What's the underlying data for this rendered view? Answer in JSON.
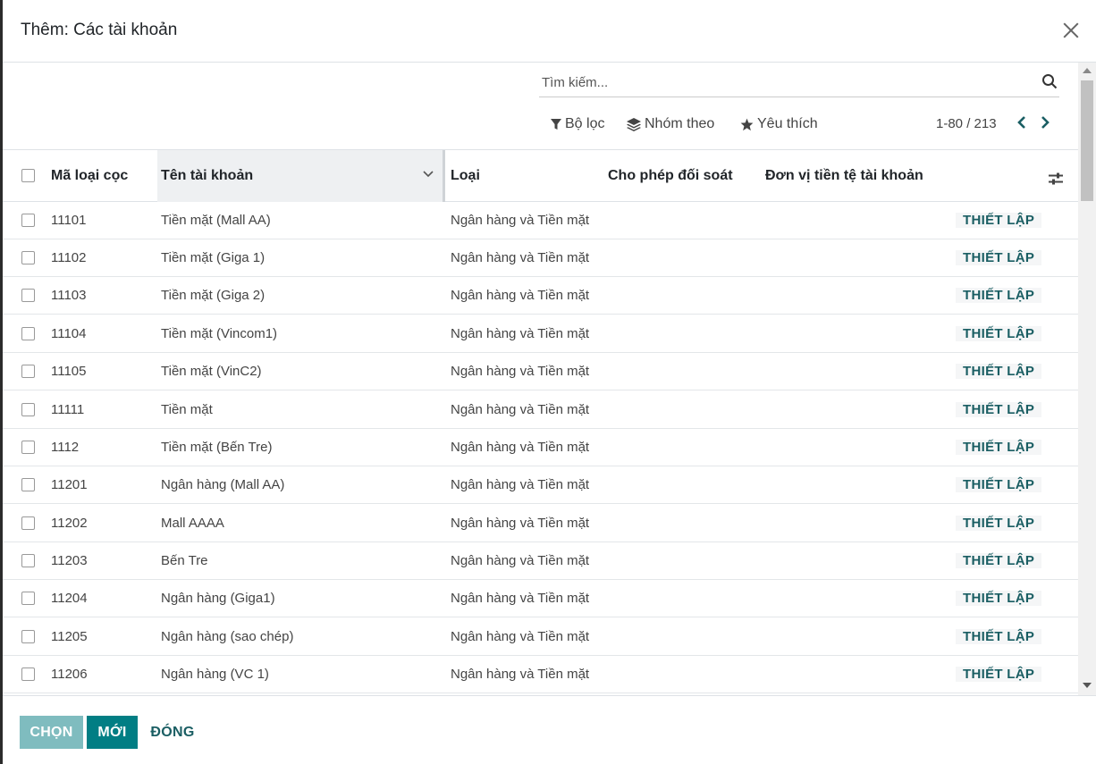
{
  "dialog": {
    "title": "Thêm: Các tài khoản"
  },
  "search": {
    "placeholder": "Tìm kiếm..."
  },
  "controls": {
    "filter_label": "Bộ lọc",
    "group_label": "Nhóm theo",
    "favorite_label": "Yêu thích",
    "pager": "1-80 / 213"
  },
  "table": {
    "headers": {
      "code": "Mã loại cọc",
      "name": "Tên tài khoản",
      "type": "Loại",
      "reconcile": "Cho phép đối soát",
      "currency": "Đơn vị tiền tệ tài khoản"
    },
    "rows": [
      {
        "code": "11101",
        "name": "Tiền mặt (Mall AA)",
        "type": "Ngân hàng và Tiền mặt",
        "action": "THIẾT LẬP"
      },
      {
        "code": "11102",
        "name": "Tiền mặt (Giga 1)",
        "type": "Ngân hàng và Tiền mặt",
        "action": "THIẾT LẬP"
      },
      {
        "code": "11103",
        "name": "Tiền mặt (Giga 2)",
        "type": "Ngân hàng và Tiền mặt",
        "action": "THIẾT LẬP"
      },
      {
        "code": "11104",
        "name": "Tiền mặt (Vincom1)",
        "type": "Ngân hàng và Tiền mặt",
        "action": "THIẾT LẬP"
      },
      {
        "code": "11105",
        "name": "Tiền mặt (VinC2)",
        "type": "Ngân hàng và Tiền mặt",
        "action": "THIẾT LẬP"
      },
      {
        "code": "11111",
        "name": "Tiền mặt",
        "type": "Ngân hàng và Tiền mặt",
        "action": "THIẾT LẬP"
      },
      {
        "code": "1112",
        "name": "Tiền mặt (Bến Tre)",
        "type": "Ngân hàng và Tiền mặt",
        "action": "THIẾT LẬP"
      },
      {
        "code": "11201",
        "name": "Ngân hàng (Mall AA)",
        "type": "Ngân hàng và Tiền mặt",
        "action": "THIẾT LẬP"
      },
      {
        "code": "11202",
        "name": "Mall AAAA",
        "type": "Ngân hàng và Tiền mặt",
        "action": "THIẾT LẬP"
      },
      {
        "code": "11203",
        "name": "Bến Tre",
        "type": "Ngân hàng và Tiền mặt",
        "action": "THIẾT LẬP"
      },
      {
        "code": "11204",
        "name": "Ngân hàng (Giga1)",
        "type": "Ngân hàng và Tiền mặt",
        "action": "THIẾT LẬP"
      },
      {
        "code": "11205",
        "name": "Ngân hàng (sao chép)",
        "type": "Ngân hàng và Tiền mặt",
        "action": "THIẾT LẬP"
      },
      {
        "code": "11206",
        "name": "Ngân hàng (VC 1)",
        "type": "Ngân hàng và Tiền mặt",
        "action": "THIẾT LẬP"
      }
    ]
  },
  "footer": {
    "select_label": "CHỌN",
    "new_label": "MỚI",
    "close_label": "ĐÓNG"
  },
  "colors": {
    "primary": "#017e84",
    "primary_disabled": "#7fbcbf",
    "link": "#1a5e63"
  }
}
